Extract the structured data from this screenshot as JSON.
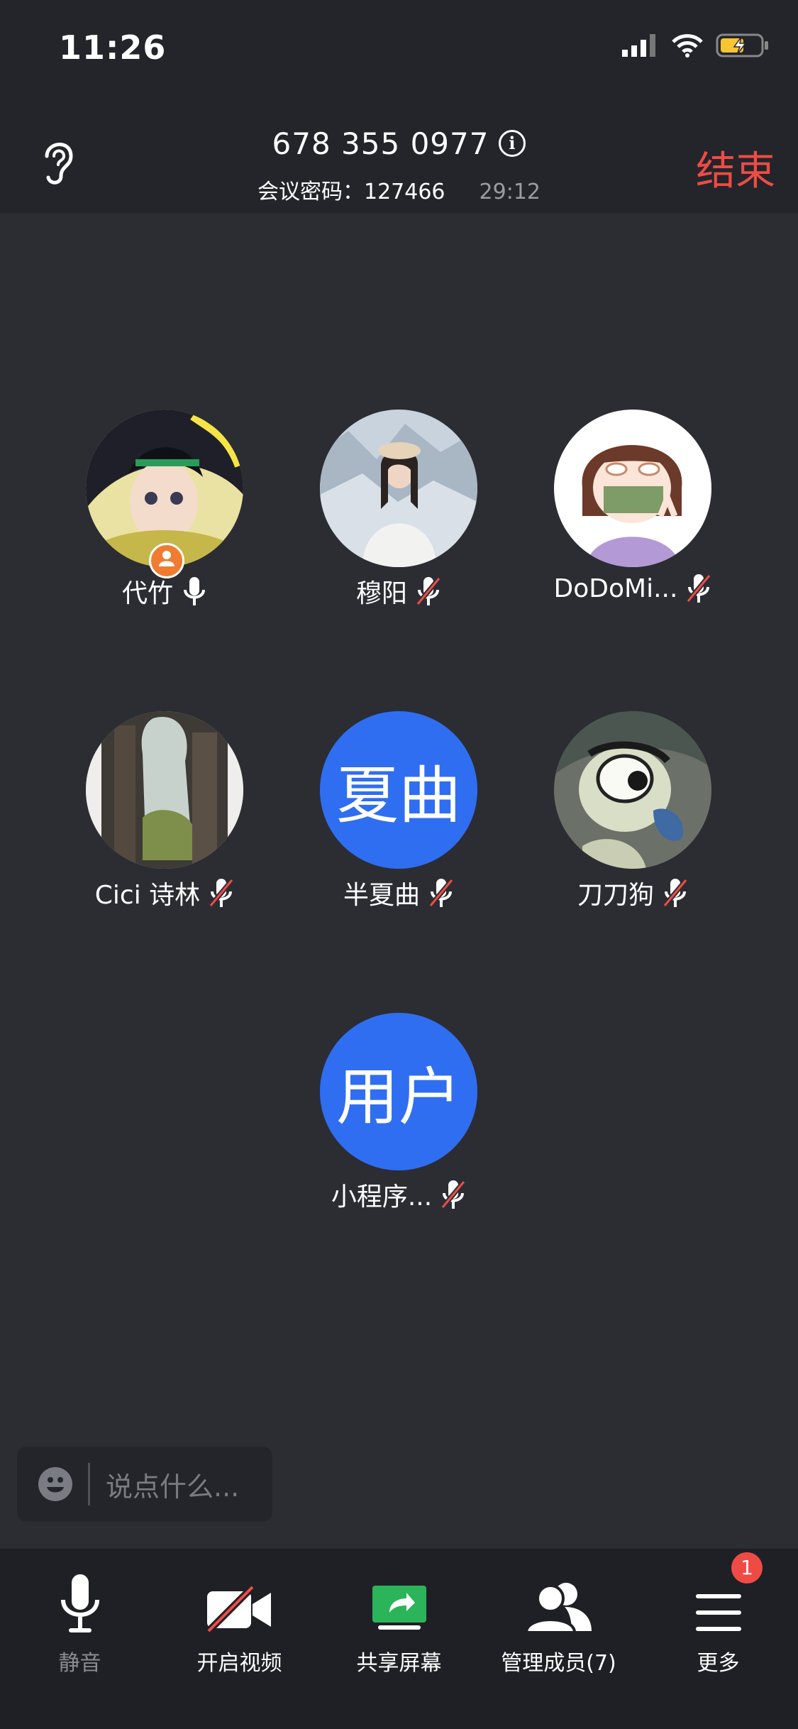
{
  "status": {
    "time": "11:26"
  },
  "meeting": {
    "number": "678 355 0977",
    "password_label": "会议密码：127466",
    "duration": "29:12",
    "end_label": "结束"
  },
  "participants": [
    {
      "name": "代竹",
      "avatar": "anime-portrait",
      "mic": "on",
      "host": true
    },
    {
      "name": "穆阳",
      "avatar": "photo-portrait",
      "mic": "muted"
    },
    {
      "name": "DoDoMi...",
      "avatar": "cartoon-girl",
      "mic": "muted"
    },
    {
      "name": "Cici 诗林",
      "avatar": "city-painting",
      "mic": "muted"
    },
    {
      "name": "半夏曲",
      "avatar_text": "夏曲",
      "avatar_color": "#2f6ef1",
      "mic": "muted"
    },
    {
      "name": "刀刀狗",
      "avatar": "cartoon-dog",
      "mic": "muted"
    },
    {
      "name": "小程序...",
      "avatar_text": "用户",
      "avatar_color": "#2f6ef1",
      "mic": "muted"
    }
  ],
  "chat": {
    "placeholder": "说点什么..."
  },
  "toolbar": {
    "mute": "静音",
    "video": "开启视频",
    "share": "共享屏幕",
    "members": "管理成员(7)",
    "more": "更多",
    "more_badge": "1"
  },
  "colors": {
    "accent": "#2f6ef1",
    "danger": "#ef4b45",
    "share_green": "#2bb45a"
  }
}
